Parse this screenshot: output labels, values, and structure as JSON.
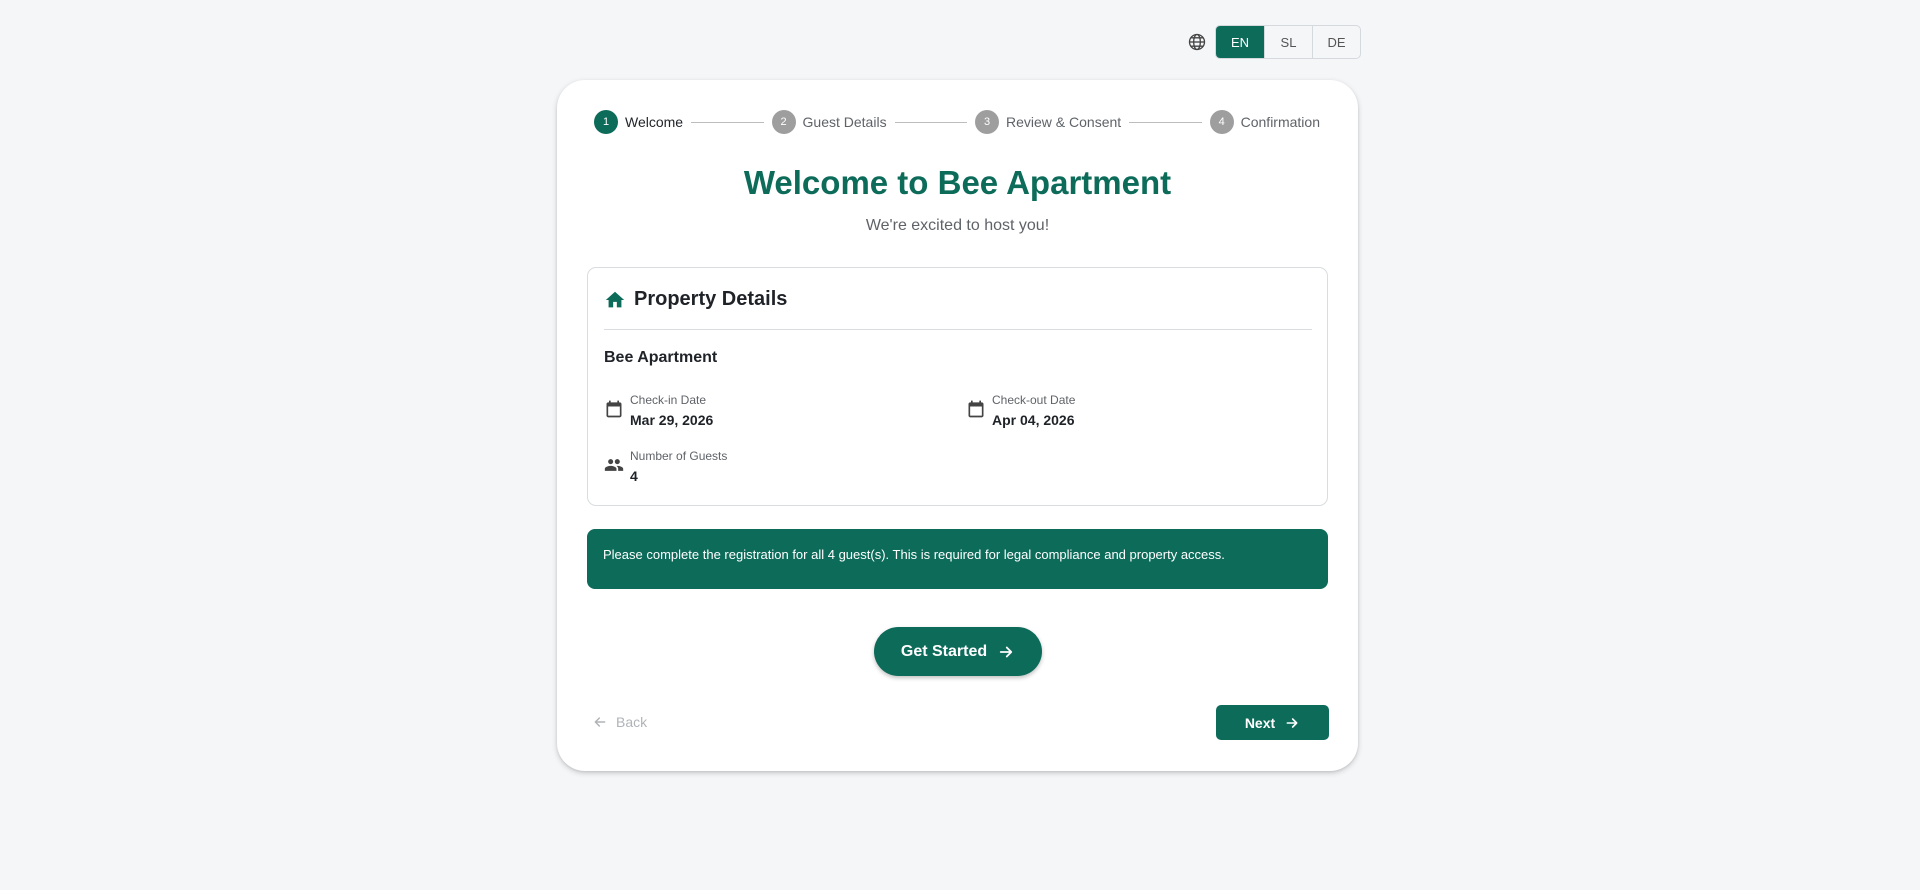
{
  "language": {
    "icon": "globe-icon",
    "options": [
      "EN",
      "SL",
      "DE"
    ],
    "active": "EN"
  },
  "stepper": {
    "steps": [
      {
        "number": "1",
        "label": "Welcome",
        "active": true
      },
      {
        "number": "2",
        "label": "Guest Details",
        "active": false
      },
      {
        "number": "3",
        "label": "Review & Consent",
        "active": false
      },
      {
        "number": "4",
        "label": "Confirmation",
        "active": false
      }
    ]
  },
  "header": {
    "title": "Welcome to Bee Apartment",
    "subtitle": "We're excited to host you!"
  },
  "details": {
    "icon": "home-icon",
    "title": "Property Details",
    "property_name": "Bee Apartment",
    "checkin": {
      "icon": "calendar-icon",
      "label": "Check-in Date",
      "value": "Mar 29, 2026"
    },
    "checkout": {
      "icon": "calendar-icon",
      "label": "Check-out Date",
      "value": "Apr 04, 2026"
    },
    "guests": {
      "icon": "people-icon",
      "label": "Number of Guests",
      "value": "4"
    }
  },
  "notice": {
    "text": "Please complete the registration for all 4 guest(s). This is required for legal compliance and property access."
  },
  "actions": {
    "get_started": "Get Started",
    "back": "Back",
    "next": "Next"
  },
  "colors": {
    "accent": "#0d6b5a",
    "background": "#f5f6f8",
    "inactive_step": "#9e9e9e"
  }
}
